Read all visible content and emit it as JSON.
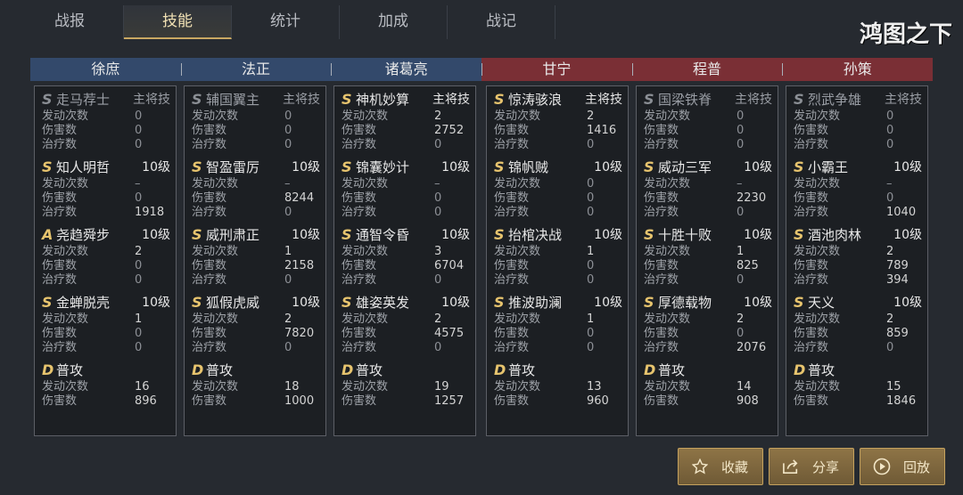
{
  "tabs": [
    "战报",
    "技能",
    "统计",
    "加成",
    "战记"
  ],
  "active_tab": 1,
  "logo_text": "鸿图之下",
  "stat_labels": {
    "count": "发动次数",
    "damage": "伤害数",
    "heal": "治疗数"
  },
  "generals": [
    {
      "name": "徐庶",
      "side": "blue",
      "skills": [
        {
          "grade": "S",
          "name": "走马荐士",
          "level": "主将技",
          "dim": true,
          "count": "0",
          "damage": "0",
          "heal": "0"
        },
        {
          "grade": "S",
          "name": "知人明哲",
          "level": "10级",
          "count": "–",
          "damage": "0",
          "heal": "1918"
        },
        {
          "grade": "A",
          "name": "尧趋舜步",
          "level": "10级",
          "count": "2",
          "damage": "0",
          "heal": "0"
        },
        {
          "grade": "S",
          "name": "金蝉脱壳",
          "level": "10级",
          "count": "1",
          "damage": "0",
          "heal": "0"
        },
        {
          "grade": "D",
          "name": "普攻",
          "level": "",
          "count": "16",
          "damage": "896"
        }
      ]
    },
    {
      "name": "法正",
      "side": "blue",
      "skills": [
        {
          "grade": "S",
          "name": "辅国翼主",
          "level": "主将技",
          "dim": true,
          "count": "0",
          "damage": "0",
          "heal": "0"
        },
        {
          "grade": "S",
          "name": "智盈雷厉",
          "level": "10级",
          "count": "–",
          "damage": "8244",
          "heal": "0"
        },
        {
          "grade": "S",
          "name": "威刑肃正",
          "level": "10级",
          "count": "1",
          "damage": "2158",
          "heal": "0"
        },
        {
          "grade": "S",
          "name": "狐假虎威",
          "level": "10级",
          "count": "2",
          "damage": "7820",
          "heal": "0"
        },
        {
          "grade": "D",
          "name": "普攻",
          "level": "",
          "count": "18",
          "damage": "1000"
        }
      ]
    },
    {
      "name": "诸葛亮",
      "side": "blue",
      "skills": [
        {
          "grade": "S",
          "name": "神机妙算",
          "level": "主将技",
          "count": "2",
          "damage": "2752",
          "heal": "0"
        },
        {
          "grade": "S",
          "name": "锦囊妙计",
          "level": "10级",
          "count": "–",
          "damage": "0",
          "heal": "0"
        },
        {
          "grade": "S",
          "name": "通智令昏",
          "level": "10级",
          "count": "3",
          "damage": "6704",
          "heal": "0"
        },
        {
          "grade": "S",
          "name": "雄姿英发",
          "level": "10级",
          "count": "2",
          "damage": "4575",
          "heal": "0"
        },
        {
          "grade": "D",
          "name": "普攻",
          "level": "",
          "count": "19",
          "damage": "1257"
        }
      ]
    },
    {
      "name": "甘宁",
      "side": "red",
      "skills": [
        {
          "grade": "S",
          "name": "惊涛骇浪",
          "level": "主将技",
          "count": "2",
          "damage": "1416",
          "heal": "0"
        },
        {
          "grade": "S",
          "name": "锦帆贼",
          "level": "10级",
          "count": "0",
          "damage": "0",
          "heal": "0"
        },
        {
          "grade": "S",
          "name": "抬棺决战",
          "level": "10级",
          "count": "1",
          "damage": "0",
          "heal": "0"
        },
        {
          "grade": "S",
          "name": "推波助澜",
          "level": "10级",
          "count": "1",
          "damage": "0",
          "heal": "0"
        },
        {
          "grade": "D",
          "name": "普攻",
          "level": "",
          "count": "13",
          "damage": "960"
        }
      ]
    },
    {
      "name": "程普",
      "side": "red",
      "skills": [
        {
          "grade": "S",
          "name": "国梁铁脊",
          "level": "主将技",
          "dim": true,
          "count": "0",
          "damage": "0",
          "heal": "0"
        },
        {
          "grade": "S",
          "name": "威动三军",
          "level": "10级",
          "count": "–",
          "damage": "2230",
          "heal": "0"
        },
        {
          "grade": "S",
          "name": "十胜十败",
          "level": "10级",
          "count": "1",
          "damage": "825",
          "heal": "0"
        },
        {
          "grade": "S",
          "name": "厚德载物",
          "level": "10级",
          "count": "2",
          "damage": "0",
          "heal": "2076"
        },
        {
          "grade": "D",
          "name": "普攻",
          "level": "",
          "count": "14",
          "damage": "908"
        }
      ]
    },
    {
      "name": "孙策",
      "side": "red",
      "skills": [
        {
          "grade": "S",
          "name": "烈武争雄",
          "level": "主将技",
          "dim": true,
          "count": "0",
          "damage": "0",
          "heal": "0"
        },
        {
          "grade": "S",
          "name": "小霸王",
          "level": "10级",
          "count": "–",
          "damage": "0",
          "heal": "1040"
        },
        {
          "grade": "S",
          "name": "酒池肉林",
          "level": "10级",
          "count": "2",
          "damage": "789",
          "heal": "394"
        },
        {
          "grade": "S",
          "name": "天义",
          "level": "10级",
          "count": "2",
          "damage": "859",
          "heal": "0"
        },
        {
          "grade": "D",
          "name": "普攻",
          "level": "",
          "count": "15",
          "damage": "1846"
        }
      ]
    }
  ],
  "buttons": {
    "favorite": "收藏",
    "share": "分享",
    "replay": "回放"
  }
}
